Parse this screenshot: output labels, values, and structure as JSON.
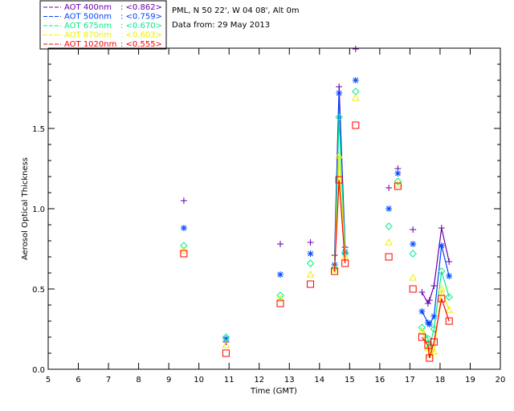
{
  "header": {
    "site": "PML, N 50 22', W 04 08', Alt 0m",
    "date": "Data from: 29 May 2013"
  },
  "chart_data": {
    "type": "line",
    "xlabel": "Time (GMT)",
    "ylabel": "Aerosol Optical Thickness",
    "xlim": [
      5,
      20
    ],
    "ylim": [
      0,
      2.0
    ],
    "xticks": [
      "5",
      "6",
      "7",
      "8",
      "9",
      "10",
      "11",
      "12",
      "13",
      "14",
      "15",
      "16",
      "17",
      "18",
      "19",
      "20"
    ],
    "yticks": [
      "0.0",
      "0.5",
      "1.0",
      "1.5"
    ],
    "x": [
      9.5,
      10.9,
      12.7,
      13.7,
      14.5,
      14.65,
      14.85,
      15.2,
      16.3,
      16.6,
      17.1,
      17.4,
      17.6,
      17.65,
      17.8,
      18.05,
      18.3
    ],
    "series": [
      {
        "name": "AOT  400nm",
        "mean": "<0.862>",
        "color": "#6600aa",
        "marker": "plus",
        "values": [
          1.05,
          0.17,
          0.78,
          0.79,
          0.71,
          1.76,
          0.76,
          2.0,
          1.13,
          1.25,
          0.87,
          0.48,
          0.41,
          0.43,
          0.52,
          0.88,
          0.67
        ]
      },
      {
        "name": "AOT  500nm",
        "mean": "<0.759>",
        "color": "#0044ff",
        "marker": "asterisk",
        "values": [
          0.88,
          0.19,
          0.59,
          0.72,
          0.65,
          1.72,
          0.73,
          1.8,
          1.0,
          1.22,
          0.78,
          0.36,
          0.29,
          0.28,
          0.33,
          0.77,
          0.58
        ]
      },
      {
        "name": "AOT  675nm",
        "mean": "<0.670>",
        "color": "#00ee88",
        "marker": "diamond",
        "values": [
          0.77,
          0.2,
          0.46,
          0.66,
          0.63,
          1.57,
          0.72,
          1.73,
          0.89,
          1.17,
          0.72,
          0.26,
          0.19,
          0.14,
          0.25,
          0.61,
          0.45
        ]
      },
      {
        "name": "AOT  870nm",
        "mean": "<0.603>",
        "color": "#eeee00",
        "marker": "triangle",
        "values": [
          0.74,
          0.15,
          0.44,
          0.59,
          0.62,
          1.33,
          0.7,
          1.69,
          0.79,
          1.15,
          0.57,
          0.24,
          0.13,
          0.09,
          0.11,
          0.5,
          0.37
        ]
      },
      {
        "name": "AOT 1020nm",
        "mean": "<0.555>",
        "color": "#ff0000",
        "marker": "square",
        "values": [
          0.72,
          0.1,
          0.41,
          0.53,
          0.61,
          1.18,
          0.66,
          1.52,
          0.7,
          1.14,
          0.5,
          0.2,
          0.15,
          0.07,
          0.17,
          0.44,
          0.3
        ]
      }
    ],
    "legend": "top-left",
    "grid": false
  }
}
